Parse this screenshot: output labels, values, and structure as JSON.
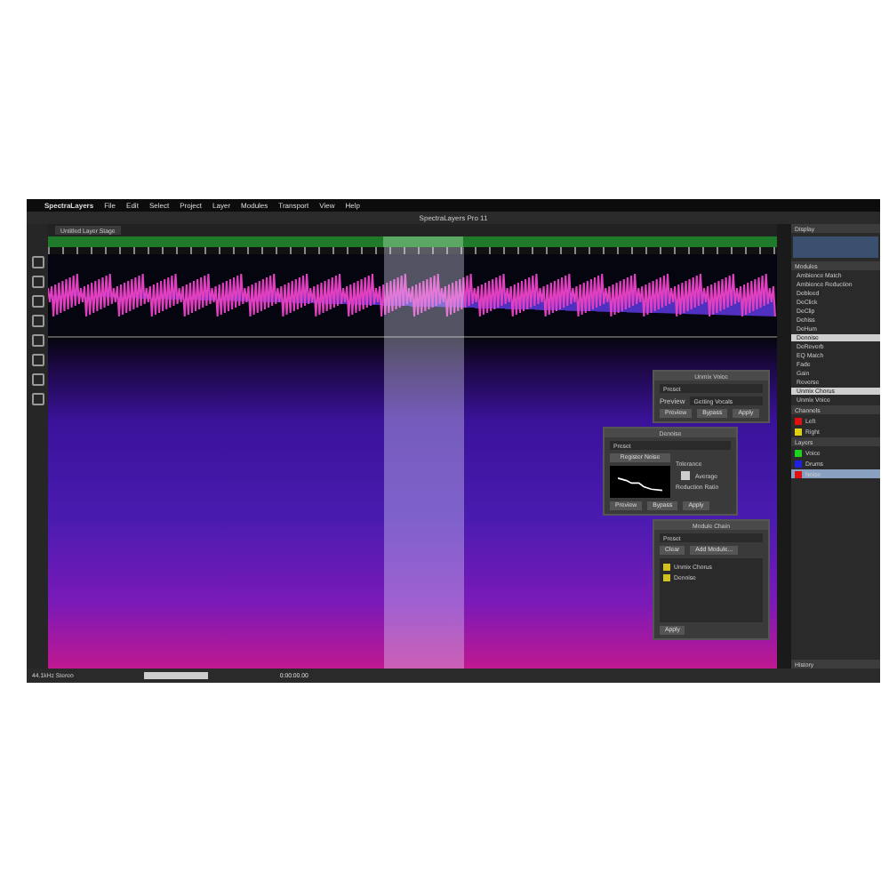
{
  "menu": [
    "SpectraLayers",
    "File",
    "Edit",
    "Select",
    "Project",
    "Layer",
    "Modules",
    "Transport",
    "View",
    "Help"
  ],
  "window": {
    "title": "SpectraLayers Pro 11"
  },
  "project_tab": {
    "label": "Untitled Layer Stage"
  },
  "display_panel": {
    "title": "Display"
  },
  "modules_panel": {
    "title": "Modules",
    "items": [
      {
        "label": "Ambience Match",
        "selected": false
      },
      {
        "label": "Ambience Reduction",
        "selected": false
      },
      {
        "label": "Debleed",
        "selected": false
      },
      {
        "label": "DeClick",
        "selected": false
      },
      {
        "label": "DeClip",
        "selected": false
      },
      {
        "label": "Dehiss",
        "selected": false
      },
      {
        "label": "DeHum",
        "selected": false
      },
      {
        "label": "Denoise",
        "selected": true
      },
      {
        "label": "DeReverb",
        "selected": false
      },
      {
        "label": "EQ Match",
        "selected": false
      },
      {
        "label": "Fade",
        "selected": false
      },
      {
        "label": "Gain",
        "selected": false
      },
      {
        "label": "Reverse",
        "selected": false
      },
      {
        "label": "Unmix Chorus",
        "selected": true
      },
      {
        "label": "Unmix Voice",
        "selected": false
      }
    ]
  },
  "channels_panel": {
    "title": "Channels",
    "items": [
      {
        "label": "Left",
        "color": "#e01010"
      },
      {
        "label": "Right",
        "color": "#e0d010"
      }
    ]
  },
  "layers_panel": {
    "title": "Layers",
    "items": [
      {
        "label": "Voice",
        "color": "#20d020",
        "selected": false
      },
      {
        "label": "Drums",
        "color": "#2020e0",
        "selected": false
      },
      {
        "label": "Noise",
        "color": "#e01010",
        "selected": true
      }
    ]
  },
  "history_panel": {
    "title": "History"
  },
  "dialogs": [
    {
      "kind": "unmix",
      "title": "Unmix Voice",
      "preset": "Preset",
      "mode_label": "Preview",
      "mode_value": "Getting Vocals",
      "buttons": [
        "Preview",
        "Bypass",
        "Apply"
      ]
    },
    {
      "kind": "denoise",
      "title": "Denoise",
      "preset": "Preset",
      "register": "Register Noise",
      "tolerance": "Tolerance",
      "average": "Average",
      "average_checked": true,
      "ratio": "Reduction Ratio",
      "buttons": [
        "Preview",
        "Bypass",
        "Apply"
      ]
    },
    {
      "kind": "chain",
      "title": "Module Chain",
      "preset": "Preset",
      "clear": "Clear",
      "add": "Add Module...",
      "items": [
        "Unmix Chorus",
        "Denoise"
      ],
      "buttons": [
        "Apply"
      ]
    }
  ],
  "status_bar": {
    "left": "44.1kHz Stereo",
    "time": "0:00:00.00"
  }
}
